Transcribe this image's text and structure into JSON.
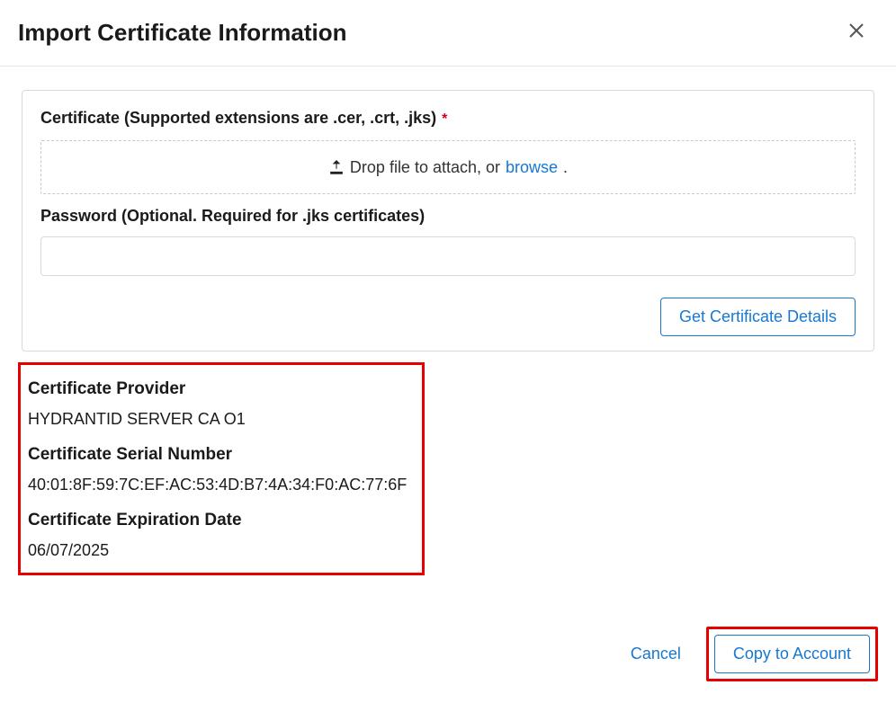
{
  "dialog": {
    "title": "Import Certificate Information"
  },
  "upload": {
    "label": "Certificate (Supported extensions are .cer, .crt, .jks)",
    "drop_text_prefix": "Drop file to attach, or ",
    "browse_text": "browse",
    "drop_text_suffix": "."
  },
  "password": {
    "label": "Password (Optional. Required for .jks certificates)",
    "value": ""
  },
  "actions": {
    "get_details": "Get Certificate Details"
  },
  "details": {
    "provider_label": "Certificate Provider",
    "provider_value": "HYDRANTID SERVER CA O1",
    "serial_label": "Certificate Serial Number",
    "serial_value": "40:01:8F:59:7C:EF:AC:53:4D:B7:4A:34:F0:AC:77:6F",
    "expiration_label": "Certificate Expiration Date",
    "expiration_value": "06/07/2025"
  },
  "footer": {
    "cancel": "Cancel",
    "copy": "Copy to Account"
  }
}
